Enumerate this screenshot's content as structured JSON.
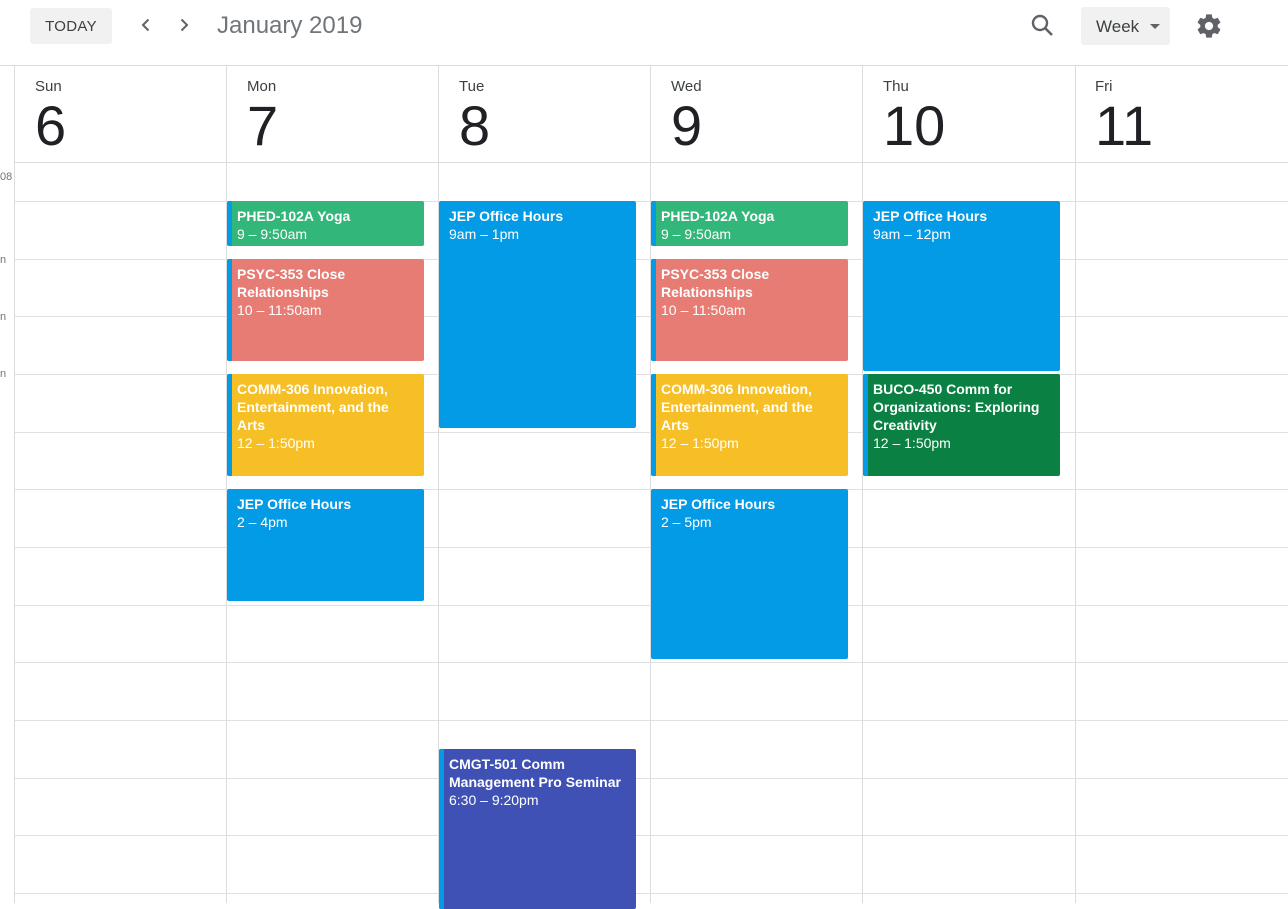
{
  "toolbar": {
    "today_label": "TODAY",
    "month_title": "January 2019",
    "view_label": "Week"
  },
  "icons": {
    "prev": "chevron-left-icon",
    "next": "chevron-right-icon",
    "search": "search-icon",
    "view_dropdown": "caret-down-icon",
    "settings": "gear-icon"
  },
  "time_labels": [
    "08",
    "n",
    "n",
    "n"
  ],
  "days": [
    {
      "dow": "Sun",
      "num": "6"
    },
    {
      "dow": "Mon",
      "num": "7"
    },
    {
      "dow": "Tue",
      "num": "8"
    },
    {
      "dow": "Wed",
      "num": "9"
    },
    {
      "dow": "Thu",
      "num": "10"
    },
    {
      "dow": "Fri",
      "num": "11"
    }
  ],
  "colors": {
    "green": "#33b679",
    "salmon": "#e67c73",
    "yellow": "#f6bf26",
    "blue": "#039be5",
    "dark_green": "#0b8043",
    "indigo": "#3f51b5",
    "accent_bar": "#039be5"
  },
  "events": [
    {
      "day": "Mon",
      "title": "PHED-102A Yoga",
      "time": "9 – 9:50am",
      "color": "#33b679"
    },
    {
      "day": "Mon",
      "title": "PSYC-353 Close Relationships",
      "time": "10 – 11:50am",
      "color": "#e67c73"
    },
    {
      "day": "Mon",
      "title": "COMM-306 Innovation, Entertainment, and the Arts",
      "time": "12 – 1:50pm",
      "color": "#f6bf26"
    },
    {
      "day": "Mon",
      "title": "JEP Office Hours",
      "time": "2 – 4pm",
      "color": "#039be5"
    },
    {
      "day": "Tue",
      "title": "JEP Office Hours",
      "time": "9am – 1pm",
      "color": "#039be5"
    },
    {
      "day": "Tue",
      "title": "CMGT-501 Comm Management Pro Seminar",
      "time": "6:30 – 9:20pm",
      "color": "#3f51b5"
    },
    {
      "day": "Wed",
      "title": "PHED-102A Yoga",
      "time": "9 – 9:50am",
      "color": "#33b679"
    },
    {
      "day": "Wed",
      "title": "PSYC-353 Close Relationships",
      "time": "10 – 11:50am",
      "color": "#e67c73"
    },
    {
      "day": "Wed",
      "title": "COMM-306 Innovation, Entertainment, and the Arts",
      "time": "12 – 1:50pm",
      "color": "#f6bf26"
    },
    {
      "day": "Wed",
      "title": "JEP Office Hours",
      "time": "2 – 5pm",
      "color": "#039be5"
    },
    {
      "day": "Thu",
      "title": "JEP Office Hours",
      "time": "9am – 12pm",
      "color": "#039be5"
    },
    {
      "day": "Thu",
      "title": "BUCO-450 Comm for Organizations: Exploring Creativity",
      "time": "12 – 1:50pm",
      "color": "#0b8043"
    }
  ]
}
